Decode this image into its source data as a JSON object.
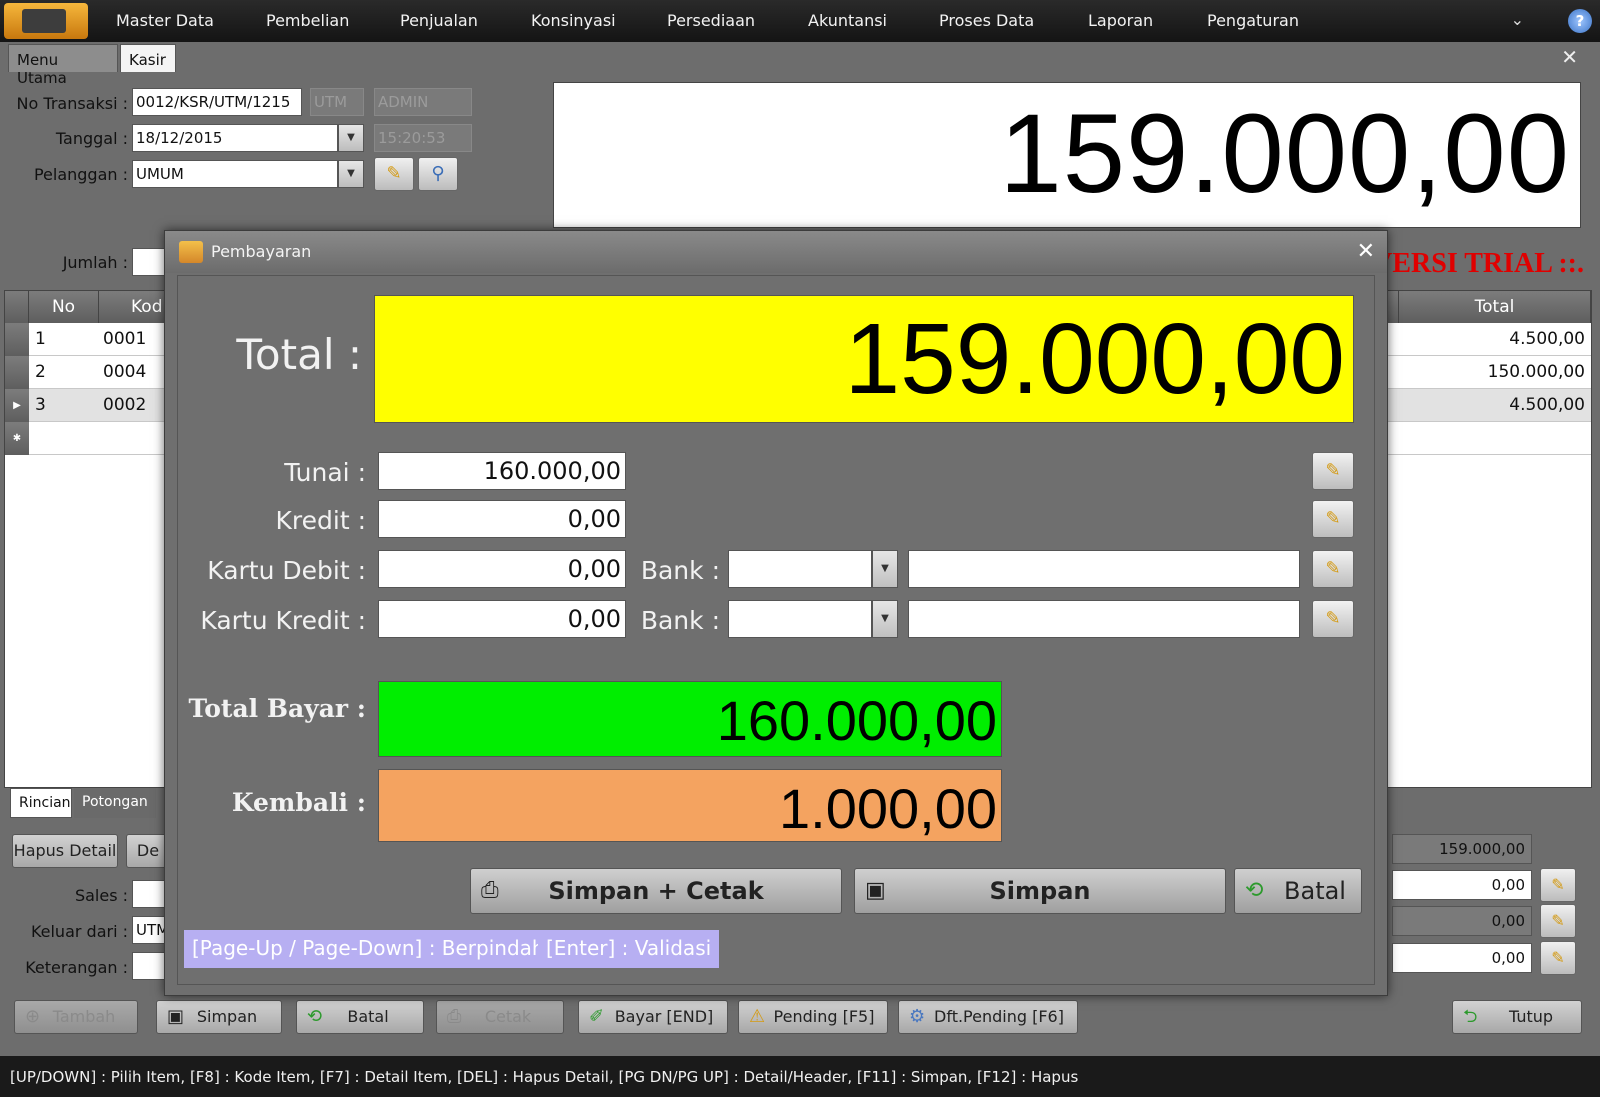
{
  "menubar": {
    "items": [
      "Master Data",
      "Pembelian",
      "Penjualan",
      "Konsinyasi",
      "Persediaan",
      "Akuntansi",
      "Proses Data",
      "Laporan",
      "Pengaturan"
    ],
    "chevron_icon": "chevron-down-icon",
    "help_icon": "help-icon"
  },
  "tabs": {
    "menu_utama": "Menu Utama",
    "kasir": "Kasir"
  },
  "header": {
    "no_transaksi_label": "No Transaksi :",
    "no_transaksi": "0012/KSR/UTM/1215",
    "branch": "UTM",
    "user": "ADMIN",
    "tanggal_label": "Tanggal :",
    "tanggal": "18/12/2015",
    "time": "15:20:53",
    "pelanggan_label": "Pelanggan :",
    "pelanggan": "UMUM",
    "jumlah_label": "Jumlah :"
  },
  "display_total": "159.000,00",
  "trial_text": "VERSI TRIAL ::.",
  "grid": {
    "columns": {
      "no": "No",
      "kode": "Kod",
      "total": "Total"
    },
    "rows": [
      {
        "no": "1",
        "kode": "0001",
        "total": "4.500,00"
      },
      {
        "no": "2",
        "kode": "0004",
        "total": "150.000,00"
      },
      {
        "no": "3",
        "kode": "0002",
        "total": "4.500,00"
      }
    ]
  },
  "lower": {
    "subtabs": {
      "rincian": "Rincian",
      "potongan": "Potongan"
    },
    "hapus_detail": "Hapus Detail",
    "de_btn": "De",
    "sales_label": "Sales :",
    "keluar_dari_label": "Keluar dari :",
    "keluar_dari": "UTM",
    "keterangan_label": "Keterangan :",
    "summary_total": "159.000,00",
    "summary_1": "0,00",
    "summary_2": "0,00",
    "summary_3": "0,00"
  },
  "toolbar": {
    "tambah": "Tambah",
    "simpan": "Simpan",
    "batal": "Batal",
    "cetak": "Cetak",
    "bayar": "Bayar [END]",
    "pending": "Pending [F5]",
    "dft_pending": "Dft.Pending [F6]",
    "tutup": "Tutup"
  },
  "statusbar": "[UP/DOWN] : Pilih Item, [F8] : Kode Item, [F7] : Detail Item, [DEL] : Hapus Detail, [PG DN/PG UP] : Detail/Header, [F11] : Simpan, [F12] : Hapus",
  "modal": {
    "title": "Pembayaran",
    "total_label": "Total :",
    "total": "159.000,00",
    "tunai_label": "Tunai :",
    "tunai": "160.000,00",
    "kredit_label": "Kredit :",
    "kredit": "0,00",
    "kartu_debit_label": "Kartu Debit :",
    "kartu_debit": "0,00",
    "kartu_kredit_label": "Kartu Kredit :",
    "kartu_kredit": "0,00",
    "bank_label": "Bank :",
    "total_bayar_label": "Total Bayar :",
    "total_bayar": "160.000,00",
    "kembali_label": "Kembali :",
    "kembali": "1.000,00",
    "btn_simpan_cetak": "Simpan + Cetak",
    "btn_simpan": "Simpan",
    "btn_batal": "Batal",
    "hint_page": "[Page-Up / Page-Down] : Berpindah",
    "hint_enter": "[Enter] : Validasi"
  },
  "colors": {
    "total_bg": "#ffff00",
    "total_bayar_bg": "#00ee00",
    "kembali_bg": "#f4a360",
    "trial_text": "#e00000",
    "hint_bg": "#b7aff2"
  }
}
